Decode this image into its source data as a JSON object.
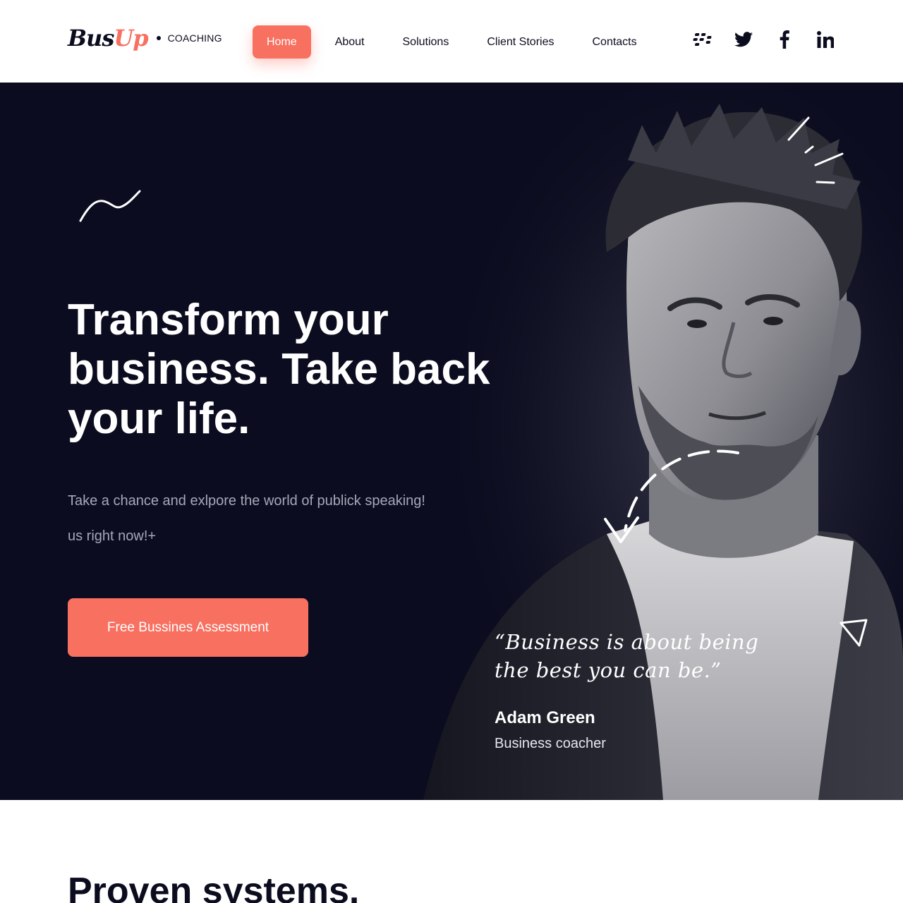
{
  "brand": {
    "logo_part1": "Bus",
    "logo_part2": "Up",
    "logo_tagline": "COACHING",
    "accent_color": "#f87060",
    "dark_color": "#0b0c1f"
  },
  "nav": {
    "items": [
      {
        "label": "Home",
        "active": true
      },
      {
        "label": "About"
      },
      {
        "label": "Solutions"
      },
      {
        "label": "Client Stories"
      },
      {
        "label": "Contacts"
      }
    ]
  },
  "socials": [
    {
      "icon": "blackberry-icon"
    },
    {
      "icon": "twitter-icon"
    },
    {
      "icon": "facebook-icon"
    },
    {
      "icon": "linkedin-icon"
    }
  ],
  "hero": {
    "title": "Transform your business. Take back your life.",
    "subtitle_line1": "Take a chance and exlpore the world of publick speaking!",
    "subtitle_line2": "us right now!+",
    "cta_label": "Free Bussines Assessment",
    "quote": "“Business is about being the best you can be.”",
    "quote_author": "Adam Green",
    "quote_role": "Business coacher"
  },
  "next_section": {
    "title": "Proven systems."
  }
}
